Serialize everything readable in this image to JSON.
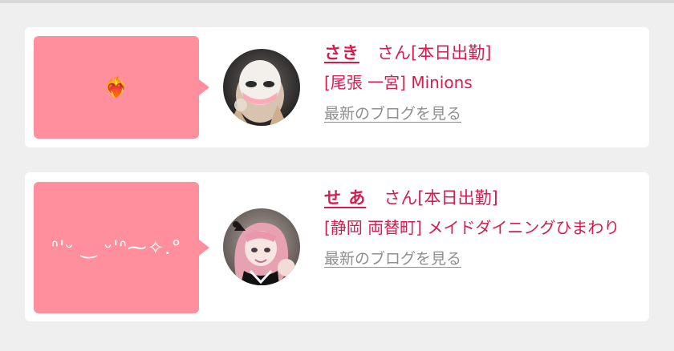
{
  "entries": [
    {
      "message": "❤️‍🔥",
      "name": "さき",
      "honorific": "さん",
      "status": "[本日出勤]",
      "shop": "[尾張 一宮] Minions",
      "blog_link": "最新のブログを見る"
    },
    {
      "message": "ᐢ'ᵕ ‿ ᵕ'ᐢ⁓✧.°",
      "name": "せ あ",
      "honorific": "さん",
      "status": "[本日出勤]",
      "shop": "[静岡 両替町] メイドダイニングひまわり",
      "blog_link": "最新のブログを見る"
    }
  ],
  "colors": {
    "bubble": "#ff8f9c",
    "accent": "#d81b4f",
    "link_gray": "#8f8f8f",
    "background": "#efefef",
    "card": "#ffffff"
  }
}
